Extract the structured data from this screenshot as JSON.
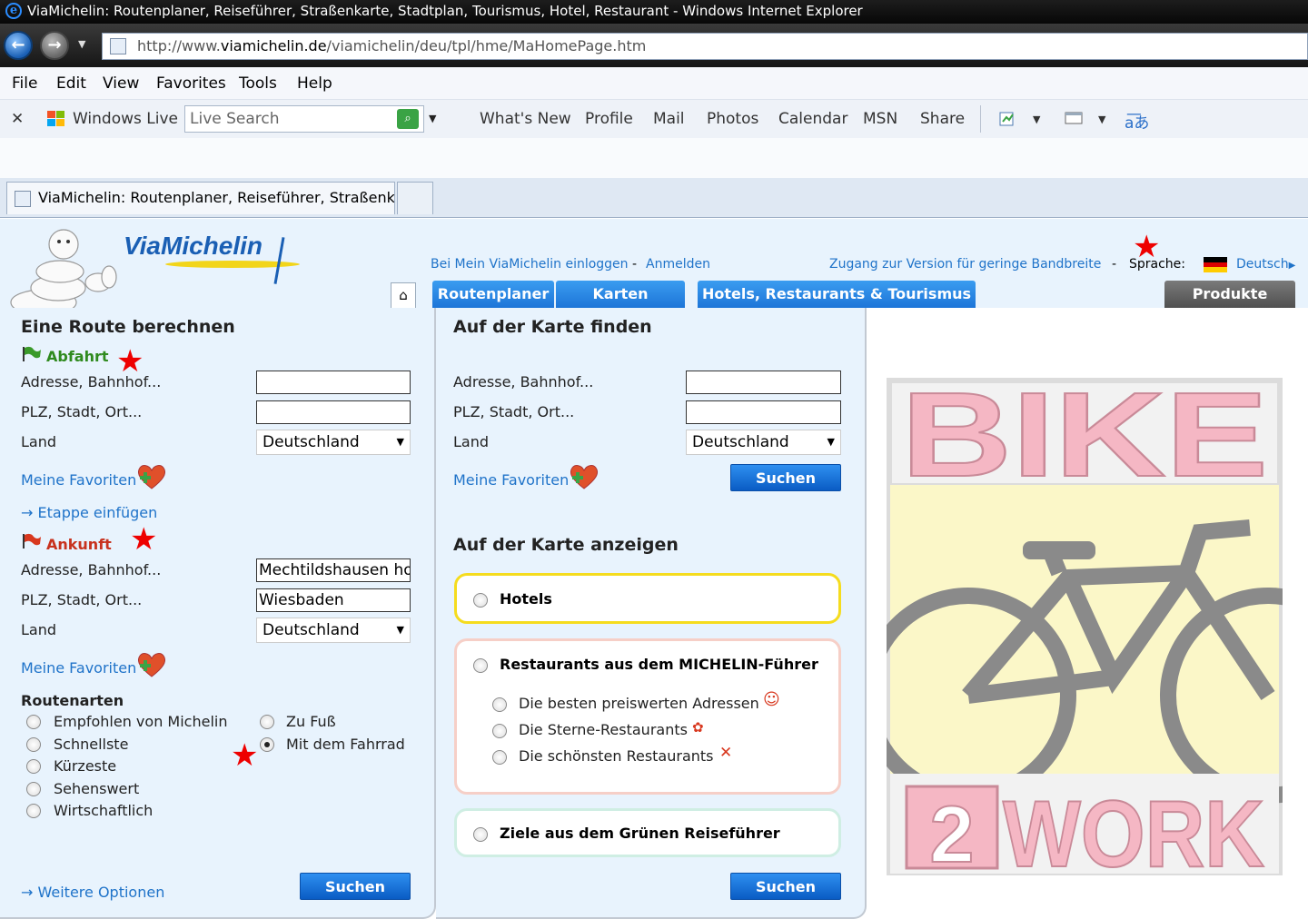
{
  "window": {
    "title": "ViaMichelin: Routenplaner, Reiseführer, Straßenkarte, Stadtplan, Tourismus, Hotel, Restaurant - Windows Internet Explorer"
  },
  "address": {
    "prefix": "http://www.",
    "host": "viamichelin.de",
    "path": "/viamichelin/deu/tpl/hme/MaHomePage.htm"
  },
  "menu": [
    "File",
    "Edit",
    "View",
    "Favorites",
    "Tools",
    "Help"
  ],
  "livebar": {
    "brand": "Windows Live",
    "search_placeholder": "Live Search",
    "links": [
      "What's New",
      "Profile",
      "Mail",
      "Photos",
      "Calendar",
      "MSN",
      "Share"
    ]
  },
  "tabs": {
    "active_title": "ViaMichelin: Routenplaner, Reiseführer, Straßenk..."
  },
  "header": {
    "logo": "ViaMichelin",
    "login_link": "Bei Mein ViaMichelin einloggen",
    "sep": "-",
    "register_link": "Anmelden",
    "lowband_link": "Zugang zur Version für geringe Bandbreite",
    "lang_label": "Sprache:",
    "lang_value": "Deutsch"
  },
  "nav": {
    "route": "Routenplaner",
    "maps": "Karten",
    "hotels": "Hotels, Restaurants & Tourismus",
    "products": "Produkte"
  },
  "route": {
    "title": "Eine Route berechnen",
    "depart_title": "Abfahrt",
    "arrive_title": "Ankunft",
    "addr_label": "Adresse, Bahnhof...",
    "plz_label": "PLZ, Stadt, Ort...",
    "land_label": "Land",
    "country": "Deutschland",
    "favorites": "Meine Favoriten",
    "add_stage": "Etappe einfügen",
    "arrive_addr": "Mechtildshausen ho",
    "arrive_city": "Wiesbaden",
    "types_title": "Routenarten",
    "types_left": [
      "Empfohlen von Michelin",
      "Schnellste",
      "Kürzeste",
      "Sehenswert",
      "Wirtschaftlich"
    ],
    "types_right": [
      "Zu Fuß",
      "Mit dem Fahrrad"
    ],
    "selected_type": "Mit dem Fahrrad",
    "more_options": "Weitere Optionen",
    "search": "Suchen"
  },
  "map_find": {
    "title": "Auf der Karte finden",
    "addr_label": "Adresse, Bahnhof...",
    "plz_label": "PLZ, Stadt, Ort...",
    "land_label": "Land",
    "country": "Deutschland",
    "favorites": "Meine Favoriten",
    "search": "Suchen"
  },
  "map_show": {
    "title": "Auf der Karte anzeigen",
    "hotels": "Hotels",
    "restaurants": "Restaurants aus dem MICHELIN-Führer",
    "resto_options": [
      "Die besten preiswerten Adressen",
      "Die Sterne-Restaurants",
      "Die schönsten Restaurants"
    ],
    "green_guide": "Ziele aus dem Grünen Reiseführer",
    "search": "Suchen"
  },
  "ad": {
    "line1": "BIKE",
    "line2_num": "2",
    "line2": "WORK"
  },
  "colors": {
    "page_bg": "#e8f3fd",
    "link": "#1f73c9",
    "button": "#0a5cc4",
    "star": "#ee0000",
    "hotel_border": "#f5dc1e",
    "resto_border": "#f6cfc7",
    "green_border": "#cfeee3"
  }
}
